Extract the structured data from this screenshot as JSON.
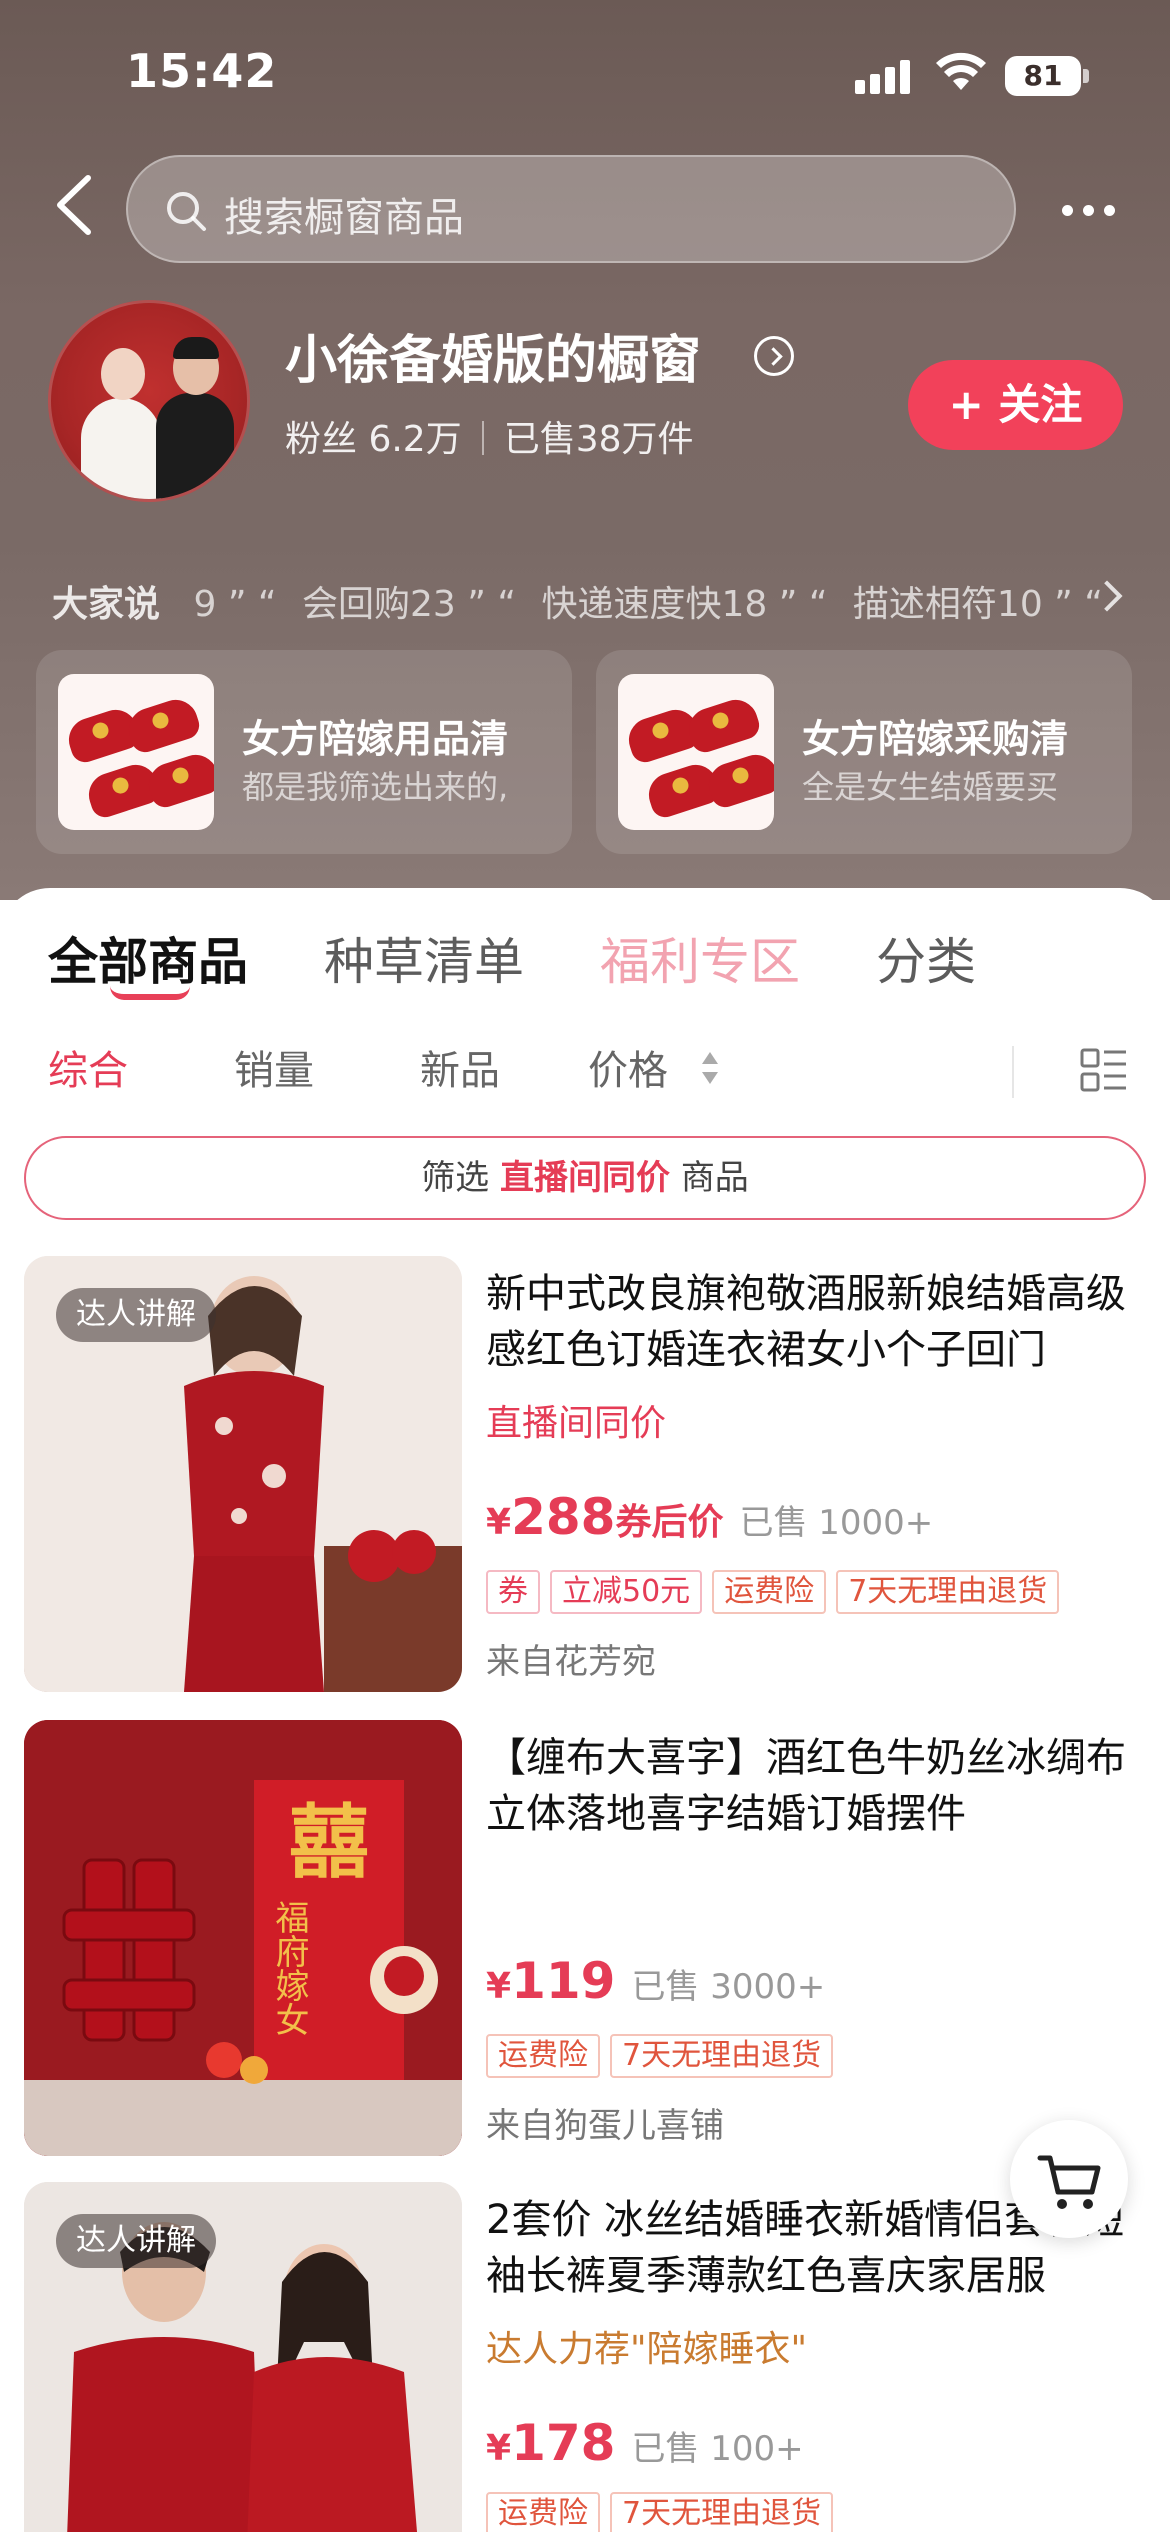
{
  "status_bar": {
    "time": "15:42",
    "battery": "81"
  },
  "header": {
    "search_placeholder": "搜索橱窗商品"
  },
  "shop": {
    "name": "小徐备婚版的橱窗",
    "followers": "粉丝 6.2万",
    "sold": "已售38万件",
    "follow_label": "+ 关注"
  },
  "reviews": {
    "lead": "大家说",
    "items": [
      "9 ” “",
      "会回购23 ” “",
      "快递速度快18 ” “",
      "描述相符10 ” “"
    ]
  },
  "lists": [
    {
      "title": "女方陪嫁用品清",
      "subtitle": "都是我筛选出来的,"
    },
    {
      "title": "女方陪嫁采购清",
      "subtitle": "全是女生结婚要买"
    }
  ],
  "tabs": [
    "全部商品",
    "种草清单",
    "福利专区",
    "分类"
  ],
  "sort": [
    "综合",
    "销量",
    "新品",
    "价格"
  ],
  "filter": {
    "prefix": "筛选",
    "highlight": "直播间同价",
    "suffix": "商品"
  },
  "products": [
    {
      "badge": "达人讲解",
      "title": "新中式改良旗袍敬酒服新娘结婚高级感红色订婚连衣裙女小个子回门",
      "tagline": "直播间同价",
      "currency": "¥",
      "price": "288",
      "price_suffix": "券后价",
      "sold": "已售 1000+",
      "tags": [
        "券",
        "立减50元",
        "运费险",
        "7天无理由退货"
      ],
      "from": "来自花芳宛"
    },
    {
      "badge": "",
      "title": "【缠布大喜字】酒红色牛奶丝冰绸布立体落地喜字结婚订婚摆件",
      "tagline": "",
      "currency": "¥",
      "price": "119",
      "price_suffix": "",
      "sold": "已售 3000+",
      "tags": [
        "运费险",
        "7天无理由退货"
      ],
      "from": "来自狗蛋儿喜铺"
    },
    {
      "badge": "达人讲解",
      "title": "2套价 冰丝结婚睡衣新婚情侣套装短袖长裤夏季薄款红色喜庆家居服",
      "tagline": "达人力荐\"陪嫁睡衣\"",
      "currency": "¥",
      "price": "178",
      "price_suffix": "",
      "sold": "已售 100+",
      "tags": [
        "运费险",
        "7天无理由退货"
      ],
      "from": ""
    }
  ],
  "image_text": {
    "xi": "囍",
    "poster": "福府嫁女"
  },
  "colors": {
    "accent": "#e53c56",
    "follow": "#f2415a",
    "header_bg": "#7a6864"
  }
}
